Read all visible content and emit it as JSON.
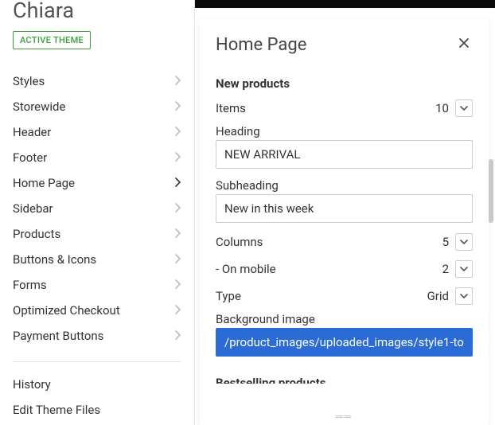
{
  "theme": {
    "name": "Chiara",
    "badge": "ACTIVE THEME"
  },
  "nav": [
    {
      "label": "Styles",
      "active": false
    },
    {
      "label": "Storewide",
      "active": false
    },
    {
      "label": "Header",
      "active": false
    },
    {
      "label": "Footer",
      "active": false
    },
    {
      "label": "Home Page",
      "active": true
    },
    {
      "label": "Sidebar",
      "active": false
    },
    {
      "label": "Products",
      "active": false
    },
    {
      "label": "Buttons & Icons",
      "active": false
    },
    {
      "label": "Forms",
      "active": false
    },
    {
      "label": "Optimized Checkout",
      "active": false
    },
    {
      "label": "Payment Buttons",
      "active": false
    }
  ],
  "nav_footer": [
    {
      "label": "History"
    },
    {
      "label": "Edit Theme Files"
    }
  ],
  "panel": {
    "title": "Home Page",
    "section": "New products",
    "items": {
      "label": "Items",
      "value": "10"
    },
    "heading": {
      "label": "Heading",
      "value": "NEW ARRIVAL"
    },
    "subheading": {
      "label": "Subheading",
      "value": "New in this week"
    },
    "columns": {
      "label": "Columns",
      "value": "5"
    },
    "on_mobile": {
      "label": "- On mobile",
      "value": "2"
    },
    "type": {
      "label": "Type",
      "value": "Grid"
    },
    "bg": {
      "label": "Background image",
      "value": "/product_images/uploaded_images/style1-to"
    },
    "section_next": "Bestselling products"
  }
}
